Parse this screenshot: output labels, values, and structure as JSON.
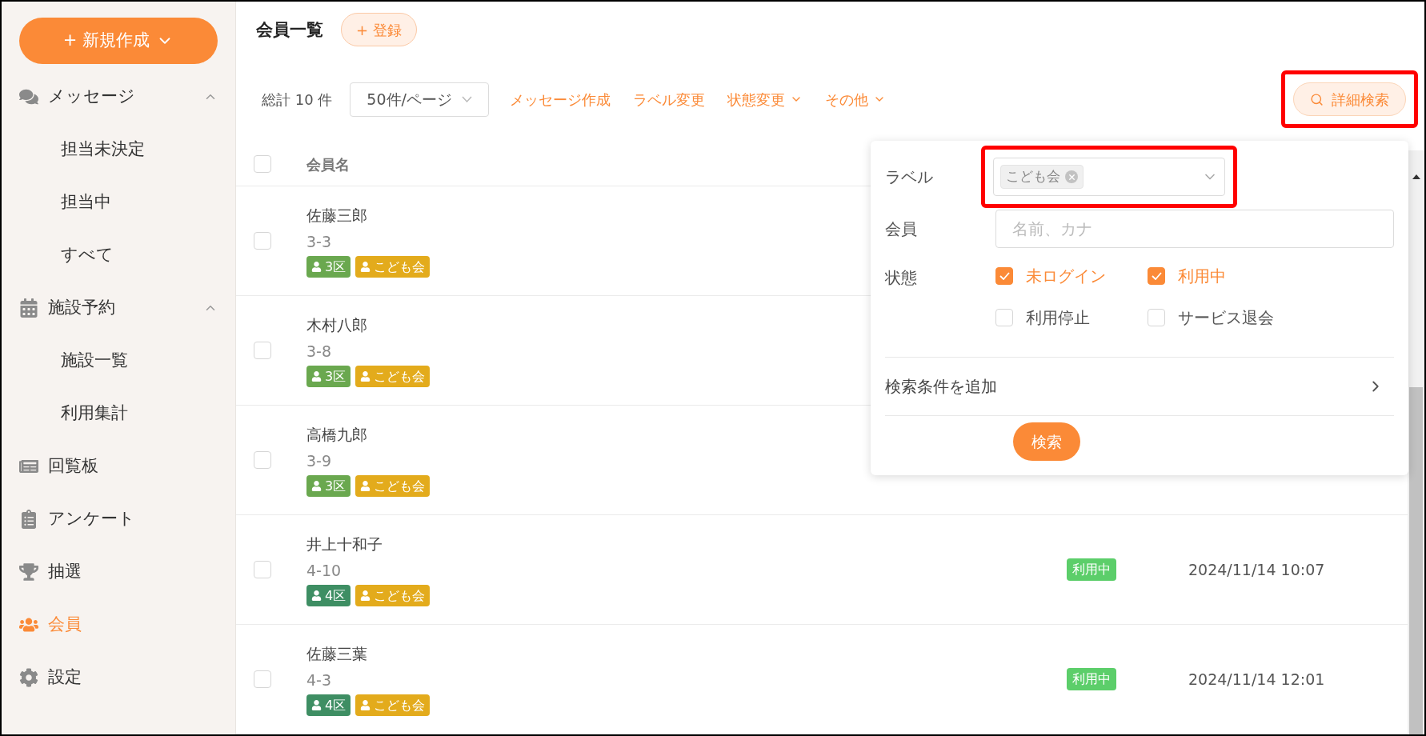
{
  "sidebar": {
    "new_button": {
      "label": "+ 新規作成"
    },
    "items": [
      {
        "kind": "chat",
        "label": "メッセージ",
        "selected": false,
        "expanded": true,
        "children": [
          {
            "label": "担当未決定",
            "selected": false
          },
          {
            "label": "担当中",
            "selected": false
          },
          {
            "label": "すべて",
            "selected": false
          }
        ]
      },
      {
        "kind": "calendar",
        "label": "施設予約",
        "selected": false,
        "expanded": true,
        "children": [
          {
            "label": "施設一覧",
            "selected": false
          },
          {
            "label": "利用集計",
            "selected": false
          }
        ]
      },
      {
        "kind": "board",
        "label": "回覧板",
        "selected": false
      },
      {
        "kind": "survey",
        "label": "アンケート",
        "selected": false
      },
      {
        "kind": "trophy",
        "label": "抽選",
        "selected": false
      },
      {
        "kind": "members",
        "label": "会員",
        "selected": true
      },
      {
        "kind": "settings",
        "label": "設定",
        "selected": false
      }
    ]
  },
  "page": {
    "title": "会員一覧",
    "register_button": "+ 登録"
  },
  "toolbar": {
    "total": "総計 10 件",
    "page_size": "50件/ページ",
    "actions": [
      {
        "label": "メッセージ作成",
        "dropdown": false
      },
      {
        "label": "ラベル変更",
        "dropdown": false
      },
      {
        "label": "状態変更",
        "dropdown": true
      },
      {
        "label": "その他",
        "dropdown": true
      }
    ],
    "search_button": {
      "label": "詳細検索",
      "highlighted": true
    }
  },
  "table": {
    "header_checked": false,
    "columns": [
      "会員名"
    ],
    "rows": [
      {
        "checked": false,
        "name": "佐藤三郎",
        "code": "3-3",
        "tags": [
          {
            "label": "3区",
            "color": "#6aa84f"
          },
          {
            "label": "こども会",
            "color": "#e3ab1c"
          }
        ]
      },
      {
        "checked": false,
        "name": "木村八郎",
        "code": "3-8",
        "tags": [
          {
            "label": "3区",
            "color": "#6aa84f"
          },
          {
            "label": "こども会",
            "color": "#e3ab1c"
          }
        ]
      },
      {
        "checked": false,
        "name": "高橋九郎",
        "code": "3-9",
        "tags": [
          {
            "label": "3区",
            "color": "#6aa84f"
          },
          {
            "label": "こども会",
            "color": "#e3ab1c"
          }
        ]
      },
      {
        "checked": false,
        "name": "井上十和子",
        "code": "4-10",
        "tags": [
          {
            "label": "4区",
            "color": "#3e8e63"
          },
          {
            "label": "こども会",
            "color": "#e3ab1c"
          }
        ],
        "status": "利用中",
        "date": "2024/11/14 10:07"
      },
      {
        "checked": false,
        "name": "佐藤三葉",
        "code": "4-3",
        "tags": [
          {
            "label": "4区",
            "color": "#3e8e63"
          },
          {
            "label": "こども会",
            "color": "#e3ab1c"
          }
        ],
        "status": "利用中",
        "date": "2024/11/14 12:01"
      }
    ]
  },
  "search_panel": {
    "label_field": {
      "label": "ラベル",
      "chips": [
        "こども会"
      ],
      "highlighted": true
    },
    "member_field": {
      "label": "会員",
      "placeholder": "名前、カナ"
    },
    "status_field": {
      "label": "状態",
      "options": [
        {
          "label": "未ログイン",
          "checked": true
        },
        {
          "label": "利用中",
          "checked": true
        },
        {
          "label": "利用停止",
          "checked": false
        },
        {
          "label": "サービス退会",
          "checked": false
        }
      ]
    },
    "add_condition": "検索条件を追加",
    "submit": "検索"
  }
}
